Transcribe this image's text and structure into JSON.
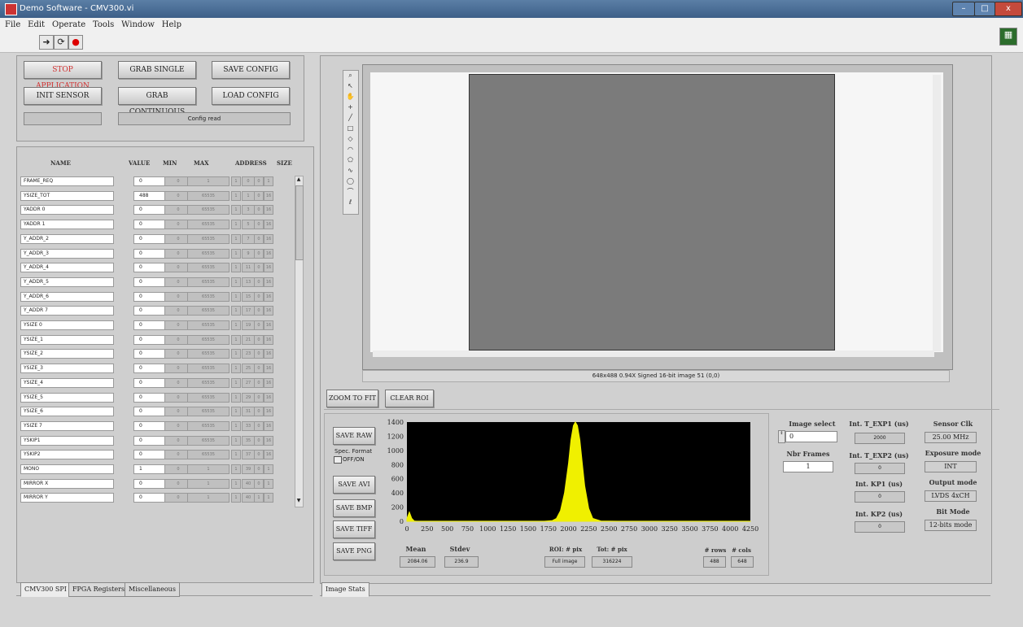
{
  "window": {
    "title": "Demo Software - CMV300.vi",
    "minimize": "–",
    "maximize": "□",
    "close": "x"
  },
  "menu": [
    "File",
    "Edit",
    "Operate",
    "Tools",
    "Window",
    "Help"
  ],
  "toolbar_icons": [
    "run-arrow-icon",
    "run-continuous-icon",
    "abort-icon"
  ],
  "controls": {
    "stop": "STOP APPLICATION",
    "grab_single": "GRAB SINGLE",
    "save_config": "SAVE CONFIG",
    "init_sensor": "INIT SENSOR",
    "grab_continuous": "GRAB CONTINUOUS",
    "load_config": "LOAD CONFIG",
    "status_left": "",
    "status_right": "Config read"
  },
  "register_table": {
    "headers": [
      "NAME",
      "VALUE",
      "MIN",
      "MAX",
      "ADDRESS",
      "SIZE"
    ],
    "rows": [
      {
        "name": "FRAME_REQ",
        "value": "0",
        "min": "0",
        "max": "1",
        "addr": [
          "1",
          "0",
          "0",
          "1"
        ]
      },
      {
        "name": "YSIZE_TOT",
        "value": "488",
        "min": "0",
        "max": "65535",
        "addr": [
          "1",
          "1",
          "0",
          "16"
        ]
      },
      {
        "name": "YADDR 0",
        "value": "0",
        "min": "0",
        "max": "65535",
        "addr": [
          "1",
          "3",
          "0",
          "16"
        ]
      },
      {
        "name": "YADDR 1",
        "value": "0",
        "min": "0",
        "max": "65535",
        "addr": [
          "1",
          "5",
          "0",
          "16"
        ]
      },
      {
        "name": "Y_ADDR_2",
        "value": "0",
        "min": "0",
        "max": "65535",
        "addr": [
          "1",
          "7",
          "0",
          "16"
        ]
      },
      {
        "name": "Y_ADDR_3",
        "value": "0",
        "min": "0",
        "max": "65535",
        "addr": [
          "1",
          "9",
          "0",
          "16"
        ]
      },
      {
        "name": "Y_ADDR_4",
        "value": "0",
        "min": "0",
        "max": "65535",
        "addr": [
          "1",
          "11",
          "0",
          "16"
        ]
      },
      {
        "name": "Y_ADDR_5",
        "value": "0",
        "min": "0",
        "max": "65535",
        "addr": [
          "1",
          "13",
          "0",
          "16"
        ]
      },
      {
        "name": "Y_ADDR_6",
        "value": "0",
        "min": "0",
        "max": "65535",
        "addr": [
          "1",
          "15",
          "0",
          "16"
        ]
      },
      {
        "name": "Y_ADDR 7",
        "value": "0",
        "min": "0",
        "max": "65535",
        "addr": [
          "1",
          "17",
          "0",
          "16"
        ]
      },
      {
        "name": "YSIZE 0",
        "value": "0",
        "min": "0",
        "max": "65535",
        "addr": [
          "1",
          "19",
          "0",
          "16"
        ]
      },
      {
        "name": "YSIZE_1",
        "value": "0",
        "min": "0",
        "max": "65535",
        "addr": [
          "1",
          "21",
          "0",
          "16"
        ]
      },
      {
        "name": "YSIZE_2",
        "value": "0",
        "min": "0",
        "max": "65535",
        "addr": [
          "1",
          "23",
          "0",
          "16"
        ]
      },
      {
        "name": "YSIZE_3",
        "value": "0",
        "min": "0",
        "max": "65535",
        "addr": [
          "1",
          "25",
          "0",
          "16"
        ]
      },
      {
        "name": "YSIZE_4",
        "value": "0",
        "min": "0",
        "max": "65535",
        "addr": [
          "1",
          "27",
          "0",
          "16"
        ]
      },
      {
        "name": "YSIZE_5",
        "value": "0",
        "min": "0",
        "max": "65535",
        "addr": [
          "1",
          "29",
          "0",
          "16"
        ]
      },
      {
        "name": "YSIZE_6",
        "value": "0",
        "min": "0",
        "max": "65535",
        "addr": [
          "1",
          "31",
          "0",
          "16"
        ]
      },
      {
        "name": "YSIZE 7",
        "value": "0",
        "min": "0",
        "max": "65535",
        "addr": [
          "1",
          "33",
          "0",
          "16"
        ]
      },
      {
        "name": "YSKIP1",
        "value": "0",
        "min": "0",
        "max": "65535",
        "addr": [
          "1",
          "35",
          "0",
          "16"
        ]
      },
      {
        "name": "YSKIP2",
        "value": "0",
        "min": "0",
        "max": "65535",
        "addr": [
          "1",
          "37",
          "0",
          "16"
        ]
      },
      {
        "name": "MONO",
        "value": "1",
        "min": "0",
        "max": "1",
        "addr": [
          "1",
          "39",
          "0",
          "1"
        ]
      },
      {
        "name": "MIRROR X",
        "value": "0",
        "min": "0",
        "max": "1",
        "addr": [
          "1",
          "40",
          "0",
          "1"
        ]
      },
      {
        "name": "MIRROR Y",
        "value": "0",
        "min": "0",
        "max": "1",
        "addr": [
          "1",
          "40",
          "1",
          "1"
        ]
      }
    ]
  },
  "left_tabs": [
    "CMV300 SPI",
    "FPGA Registers",
    "Miscellaneous"
  ],
  "image_info": "648x488 0.94X Signed 16-bit image 51   (0,0)",
  "image_buttons": {
    "zoom": "ZOOM TO FIT",
    "clear_roi": "CLEAR ROI"
  },
  "save_buttons": {
    "raw": "SAVE RAW",
    "spec_format": "Spec. Format",
    "offon": "OFF/ON",
    "avi": "SAVE AVI",
    "bmp": "SAVE BMP",
    "tiff": "SAVE TIFF",
    "png": "SAVE PNG"
  },
  "stats": {
    "mean_label": "Mean",
    "mean": "2084.06",
    "stdev_label": "Stdev",
    "stdev": "236.9",
    "roi_label": "ROI: # pix",
    "roi": "Full image",
    "tot_label": "Tot: # pix",
    "tot": "316224",
    "rows_label": "# rows",
    "rows": "488",
    "cols_label": "# cols",
    "cols": "648"
  },
  "right_controls": {
    "image_select_label": "Image select",
    "image_select": "0",
    "nbr_frames_label": "Nbr Frames",
    "nbr_frames": "1",
    "int_texp1_label": "Int. T_EXP1 (us)",
    "int_texp1": "2000",
    "int_texp2_label": "Int. T_EXP2 (us)",
    "int_texp2": "0",
    "int_kp1_label": "Int. KP1 (us)",
    "int_kp1": "0",
    "int_kp2_label": "Int. KP2 (us)",
    "int_kp2": "0",
    "sensor_clk_label": "Sensor Clk",
    "sensor_clk": "25.00 MHz",
    "exposure_mode_label": "Exposure mode",
    "exposure_mode": "INT",
    "output_mode_label": "Output mode",
    "output_mode": "LVDS 4xCH",
    "bit_mode_label": "Bit Mode",
    "bit_mode": "12-bits mode"
  },
  "right_tab": "Image Stats",
  "chart_data": {
    "type": "area",
    "xlim": [
      0,
      4250
    ],
    "ylim": [
      0,
      1400
    ],
    "xticks": [
      "0",
      "250",
      "500",
      "750",
      "1000",
      "1250",
      "1500",
      "1750",
      "2000",
      "2250",
      "2500",
      "2750",
      "3000",
      "3250",
      "3500",
      "3750",
      "4000",
      "4250"
    ],
    "yticks": [
      "1400",
      "1200",
      "1000",
      "800",
      "600",
      "400",
      "200",
      "0"
    ],
    "x": [
      0,
      30,
      60,
      90,
      120,
      1700,
      1800,
      1850,
      1900,
      1950,
      2000,
      2030,
      2060,
      2084,
      2110,
      2140,
      2170,
      2200,
      2250,
      2300,
      2400,
      2600,
      4250
    ],
    "values": [
      40,
      130,
      40,
      5,
      2,
      2,
      10,
      40,
      150,
      400,
      820,
      1150,
      1350,
      1400,
      1350,
      1150,
      820,
      500,
      180,
      40,
      5,
      2,
      2
    ],
    "color": "#f0f000",
    "background": "#000000"
  }
}
